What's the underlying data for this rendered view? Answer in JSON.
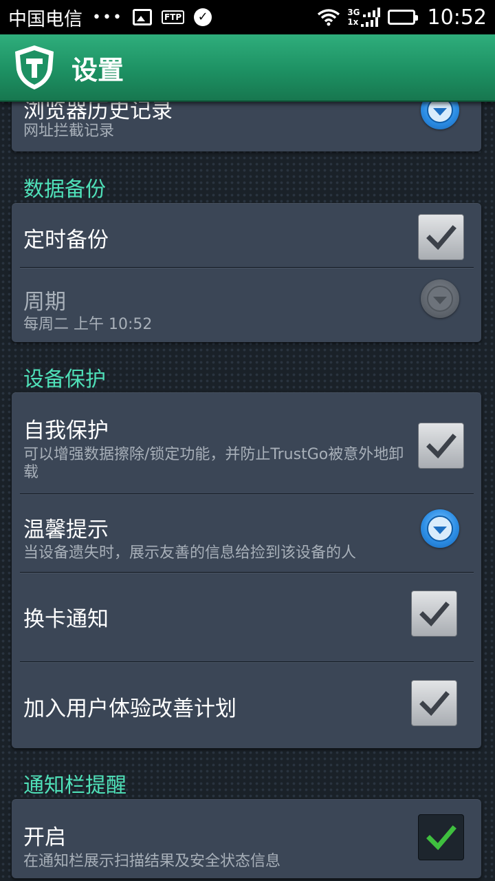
{
  "status_bar": {
    "carrier": "中国电信",
    "dots": "•••",
    "ftp_label": "FTP",
    "network_top": "3G",
    "network_bottom": "1x",
    "time": "10:52",
    "icons": [
      "image-icon",
      "ftp-icon",
      "check-circle-icon",
      "wifi-icon",
      "signal-icon",
      "battery-icon"
    ]
  },
  "app_bar": {
    "title": "设置",
    "logo_icon": "trustgo-shield-icon",
    "logo_letter": "T"
  },
  "sections": {
    "browser_history": {
      "title": "浏览器历史记录",
      "subtitle": "网址拦截记录",
      "control": "dropdown"
    },
    "data_backup": {
      "header": "数据备份",
      "scheduled_backup": {
        "title": "定时备份",
        "checked": true
      },
      "period": {
        "title": "周期",
        "subtitle": "每周二 上午 10:52",
        "enabled": false
      }
    },
    "device_protection": {
      "header": "设备保护",
      "self_protection": {
        "title": "自我保护",
        "subtitle": "可以增强数据擦除/锁定功能，并防止TrustGo被意外地卸载",
        "checked": true
      },
      "warm_reminder": {
        "title": "温馨提示",
        "subtitle": "当设备遗失时，展示友善的信息给捡到该设备的人"
      },
      "sim_change": {
        "title": "换卡通知",
        "checked": true
      },
      "ux_program": {
        "title": "加入用户体验改善计划",
        "checked": true
      }
    },
    "notification_bar": {
      "header": "通知栏提醒",
      "enable": {
        "title": "开启",
        "subtitle": "在通知栏展示扫描结果及安全状态信息",
        "checked": true
      }
    }
  },
  "colors": {
    "accent_green": "#1d9163",
    "section_header": "#4fe0b8",
    "card_bg": "#3b4656",
    "check_green": "#3fbf3f"
  }
}
